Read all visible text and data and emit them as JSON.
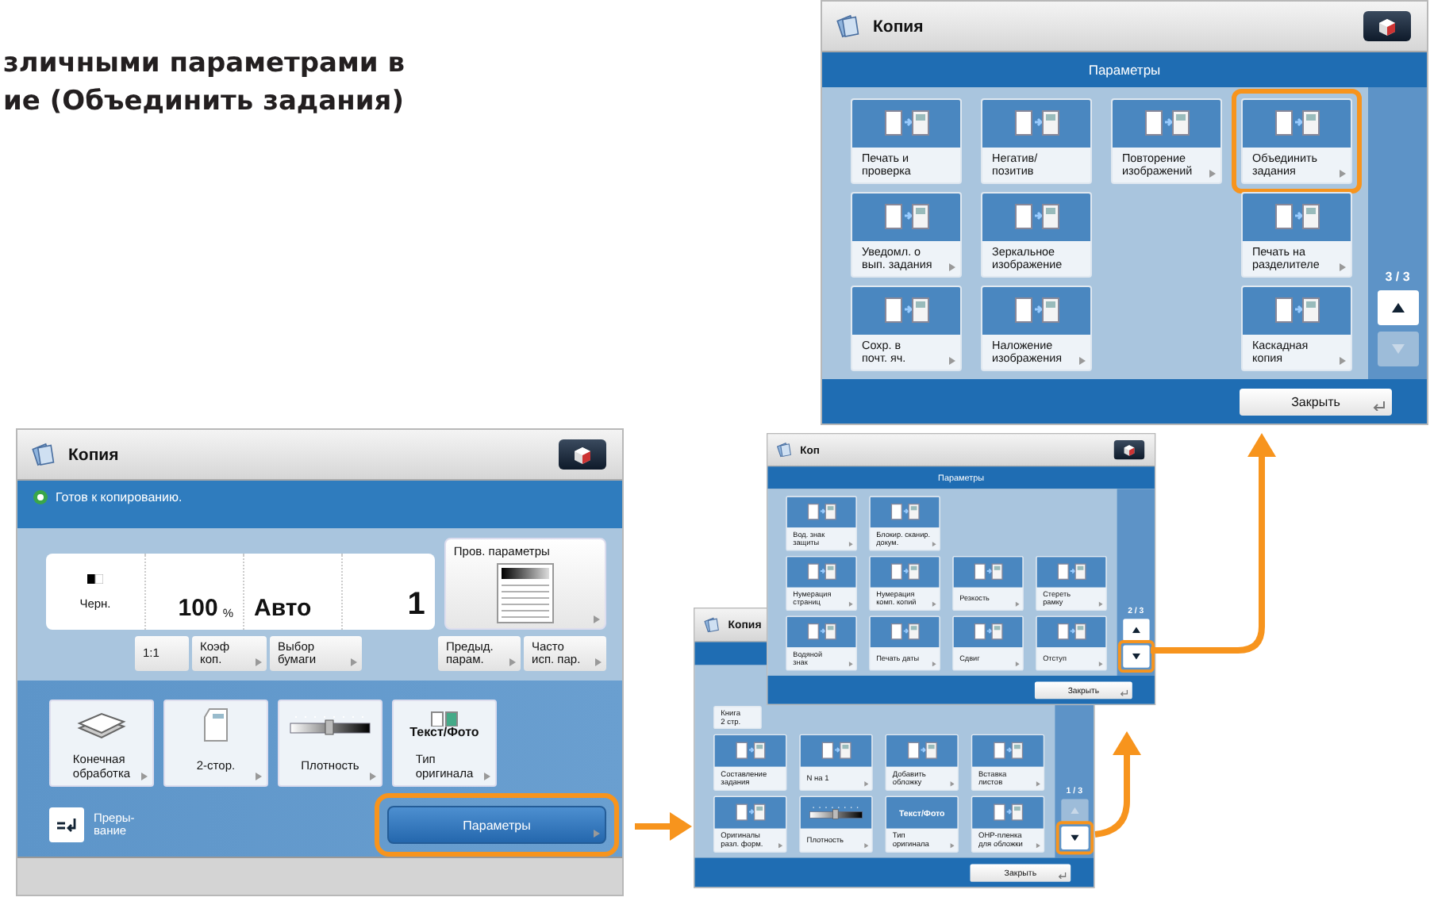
{
  "heading": {
    "lines": [
      "зличными параметрами в",
      "ие (Объединить задания)"
    ]
  },
  "screens": [
    {
      "kind": "main",
      "title": "Копия",
      "status": "Готов к копированию.",
      "color_mode": "Черн.",
      "ratio": "100",
      "ratio_unit": "%",
      "paper": "Авто",
      "copies": "1",
      "preview": "Пров. параметры",
      "ratio_buttons": [
        "1:1",
        "Коэф\nкоп.",
        "Выбор\nбумаги"
      ],
      "recall_buttons": [
        "Предыд.\nпарам.",
        "Часто\nисп. пар."
      ],
      "functions": [
        {
          "kind": "finishing",
          "label": "Конечная\nобработка"
        },
        {
          "kind": "duplex",
          "label": "2-стор."
        },
        {
          "kind": "slider",
          "label": "Плотность"
        },
        {
          "kind": "original",
          "label": "Тип\nоригинала",
          "icon_text": "Текст/Фото"
        }
      ],
      "interrupt": "Преры-\nвание",
      "options_button": {
        "label": "Параметры",
        "highlighted": true
      }
    },
    {
      "kind": "options",
      "title": "Копия",
      "page": "1 / 3",
      "up_disabled": true,
      "down_disabled": false,
      "down_highlighted": true,
      "close": "Закрыть",
      "rows": [
        [
          {
            "kind": "pages",
            "label": "Книга\n2 стр.",
            "submenu": false,
            "highlighted": false
          },
          null,
          null,
          null
        ],
        [
          {
            "kind": "pages",
            "label": "Составление\nзадания",
            "submenu": false,
            "highlighted": false
          },
          {
            "kind": "pages",
            "label": "N на 1",
            "submenu": true,
            "highlighted": false
          },
          {
            "kind": "pages",
            "label": "Добавить\nобложку",
            "submenu": true,
            "highlighted": false
          },
          {
            "kind": "pages",
            "label": "Вставка\nлистов",
            "submenu": true,
            "highlighted": false
          }
        ],
        [
          {
            "kind": "pages",
            "label": "Оригиналы\nразл. форм.",
            "submenu": true,
            "highlighted": false
          },
          {
            "kind": "slider",
            "label": "Плотность",
            "submenu": true,
            "highlighted": false
          },
          {
            "kind": "text",
            "icon_text": "Текст/Фото",
            "label": "Тип\nоригинала",
            "submenu": true,
            "highlighted": false
          },
          {
            "kind": "pages",
            "label": "OHP-пленка\nдля обложки",
            "submenu": true,
            "highlighted": false
          }
        ]
      ]
    },
    {
      "kind": "options",
      "title": "Коп",
      "header": "Параметры",
      "page": "2 / 3",
      "up_disabled": false,
      "down_disabled": false,
      "down_highlighted": true,
      "close": "Закрыть",
      "rows": [
        [
          {
            "kind": "pages",
            "label": "Вод. знак\nзащиты",
            "submenu": true,
            "highlighted": false
          },
          {
            "kind": "pages",
            "label": "Блокир. сканир.\nдокум.",
            "submenu": true,
            "highlighted": false
          },
          null,
          null
        ],
        [
          {
            "kind": "pages",
            "label": "Нумерация\nстраниц",
            "submenu": true,
            "highlighted": false
          },
          {
            "kind": "pages",
            "label": "Нумерация\nкомп. копий",
            "submenu": true,
            "highlighted": false
          },
          {
            "kind": "pages",
            "label": "Резкость",
            "submenu": true,
            "highlighted": false
          },
          {
            "kind": "pages",
            "label": "Стереть\nрамку",
            "submenu": true,
            "highlighted": false
          }
        ],
        [
          {
            "kind": "pages",
            "label": "Водяной\nзнак",
            "submenu": true,
            "highlighted": false
          },
          {
            "kind": "pages",
            "label": "Печать даты",
            "submenu": true,
            "highlighted": false
          },
          {
            "kind": "pages",
            "label": "Сдвиг",
            "submenu": true,
            "highlighted": false
          },
          {
            "kind": "pages",
            "label": "Отступ",
            "submenu": true,
            "highlighted": false
          }
        ]
      ]
    },
    {
      "kind": "options",
      "title": "Копия",
      "header": "Параметры",
      "page": "3 / 3",
      "up_disabled": false,
      "down_disabled": true,
      "down_highlighted": false,
      "close": "Закрыть",
      "rows": [
        [
          {
            "kind": "pages",
            "label": "Печать и\nпроверка",
            "submenu": false,
            "highlighted": false
          },
          {
            "kind": "pages",
            "label": "Негатив/\nпозитив",
            "submenu": false,
            "highlighted": false
          },
          {
            "kind": "pages",
            "label": "Повторение\nизображений",
            "submenu": true,
            "highlighted": false
          },
          {
            "kind": "pages",
            "label": "Объединить\nзадания",
            "submenu": true,
            "highlighted": true
          }
        ],
        [
          {
            "kind": "pages",
            "label": "Уведомл. о\nвып. задания",
            "submenu": true,
            "highlighted": false
          },
          {
            "kind": "pages",
            "label": "Зеркальное\nизображение",
            "submenu": false,
            "highlighted": false
          },
          null,
          {
            "kind": "pages",
            "label": "Печать на\nразделителе",
            "submenu": true,
            "highlighted": false
          }
        ],
        [
          {
            "kind": "pages",
            "label": "Сохр. в\nпочт. яч.",
            "submenu": true,
            "highlighted": false
          },
          {
            "kind": "pages",
            "label": "Наложение\nизображения",
            "submenu": true,
            "highlighted": false
          },
          null,
          {
            "kind": "pages",
            "label": "Каскадная\nкопия",
            "submenu": true,
            "highlighted": false
          }
        ]
      ]
    }
  ]
}
